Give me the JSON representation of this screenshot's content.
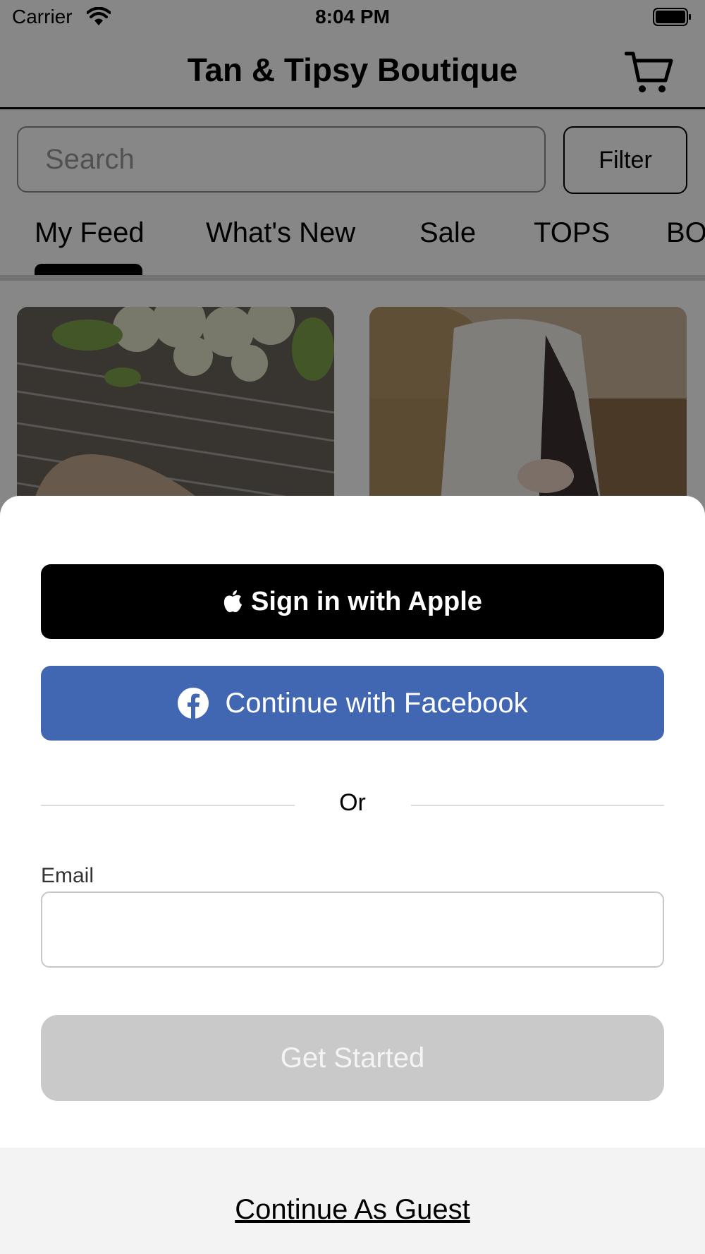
{
  "status_bar": {
    "carrier": "Carrier",
    "time": "8:04 PM",
    "icons": [
      "wifi-icon",
      "battery-icon"
    ]
  },
  "header": {
    "title": "Tan & Tipsy Boutique",
    "cart_icon": "cart-icon"
  },
  "search": {
    "placeholder": "Search",
    "value": "",
    "filter_label": "Filter"
  },
  "tabs": [
    {
      "label": "My Feed",
      "active": true
    },
    {
      "label": "What's New",
      "active": false
    },
    {
      "label": "Sale",
      "active": false
    },
    {
      "label": "TOPS",
      "active": false
    },
    {
      "label": "BO",
      "active": false
    }
  ],
  "sign_in_sheet": {
    "apple_label": "Sign in with Apple",
    "apple_icon": "apple-icon",
    "facebook_label": "Continue with Facebook",
    "facebook_icon": "facebook-icon",
    "or_text": "Or",
    "email_label": "Email",
    "email_value": "",
    "get_started_label": "Get Started",
    "guest_label": "Continue As Guest"
  },
  "colors": {
    "facebook_blue": "#4267b2",
    "apple_black": "#000000",
    "disabled_gray": "#c9c9c9",
    "guest_background": "#f3f3f3",
    "overlay": "rgba(0,0,0,0.47)"
  }
}
